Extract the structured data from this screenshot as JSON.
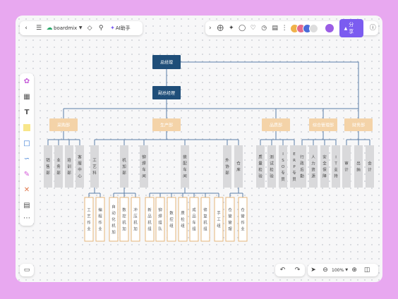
{
  "app": {
    "name": "boardmix",
    "ai_label": "AI助手"
  },
  "topbar": {
    "share_label": "分享",
    "zoom": "100%"
  },
  "colors": {
    "top_box": "#1f4e79",
    "dept": "#f4d3a8",
    "dept_text": "#ffffff",
    "col": "#d9d9db",
    "team_border": "#e4b67a",
    "line": "#5a7ea8"
  },
  "chart": {
    "top": "总经理",
    "deputy": "副总经理",
    "depts": [
      {
        "name": "采购部",
        "cols": [
          "销售部",
          "业务部",
          "培训部",
          "客服中心"
        ]
      },
      {
        "name": "生产部",
        "cols": [
          "工艺科",
          "机加部",
          "铆焊车间",
          "装配车间",
          "外协部",
          "仓库"
        ]
      },
      {
        "name": "品质部",
        "cols": [
          "质量检验",
          "测试检验",
          "ISO专员",
          "ERP专员"
        ]
      },
      {
        "name": "综合管理部",
        "cols": [
          "行政后勤",
          "人力资源",
          "安全保障",
          "IT支持"
        ]
      },
      {
        "name": "财务部",
        "cols": [
          "审计",
          "出纳",
          "会计"
        ]
      }
    ],
    "mid": [
      "工艺科",
      "机加部",
      "铆焊部",
      "装订部",
      "外协部",
      "仓库"
    ],
    "teams": [
      "工艺作业",
      "编程作业",
      "自动化机加",
      "数控机加",
      "冲压机加",
      "新品机组",
      "铆焊组队",
      "数控组",
      "质检组",
      "成品车组",
      "修复机组",
      "手工组",
      "仓管管理",
      "仓管作业"
    ]
  }
}
